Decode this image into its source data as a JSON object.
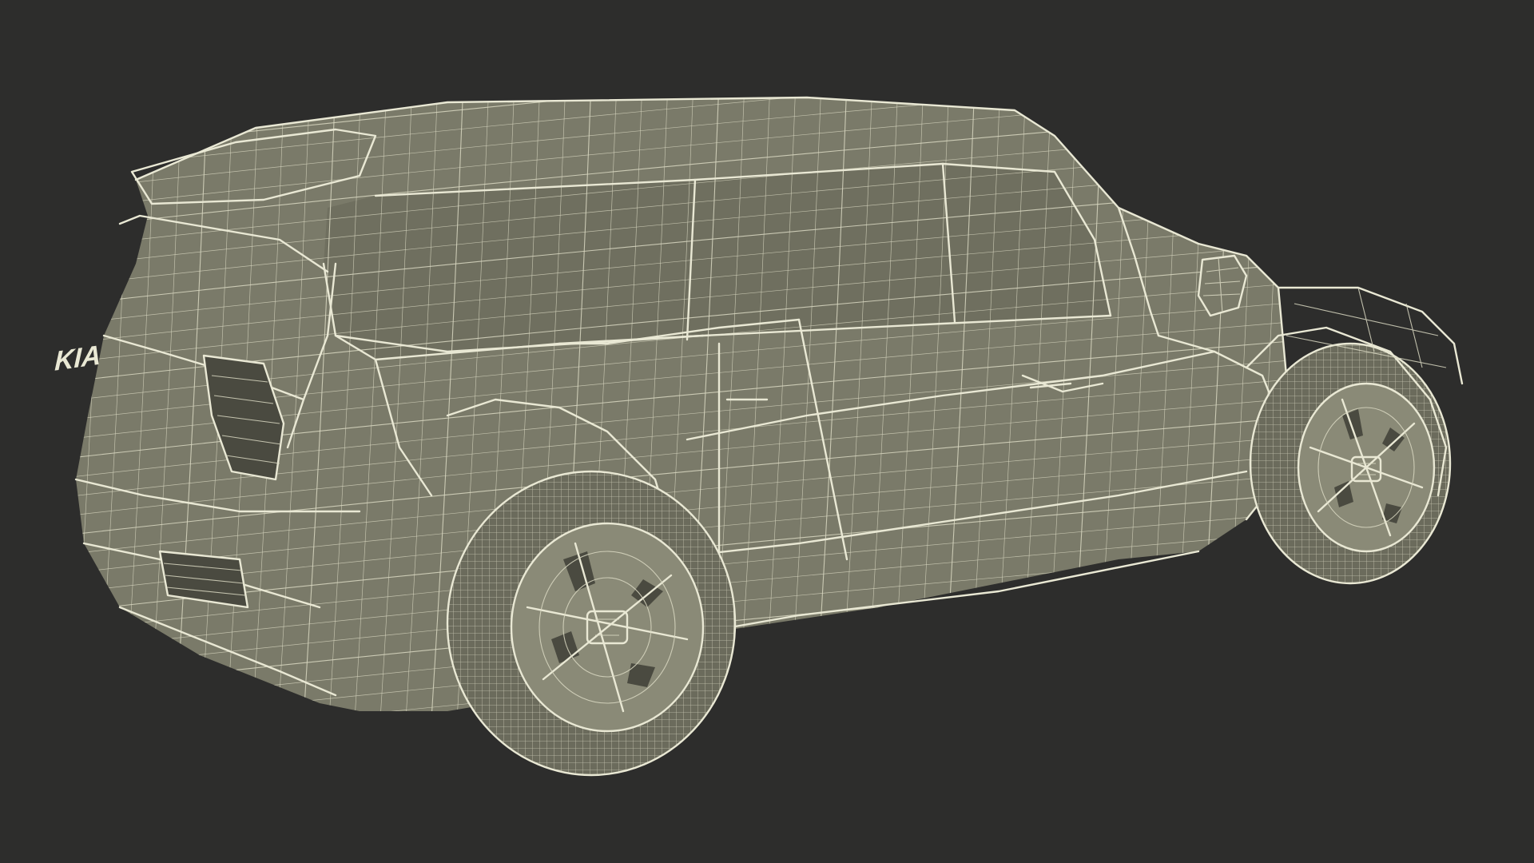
{
  "scene": {
    "background": "#2d2d2c",
    "surface_color": "#7a7a69",
    "wire_color": "#e9e8d4"
  },
  "badge": {
    "text": "KIA"
  }
}
